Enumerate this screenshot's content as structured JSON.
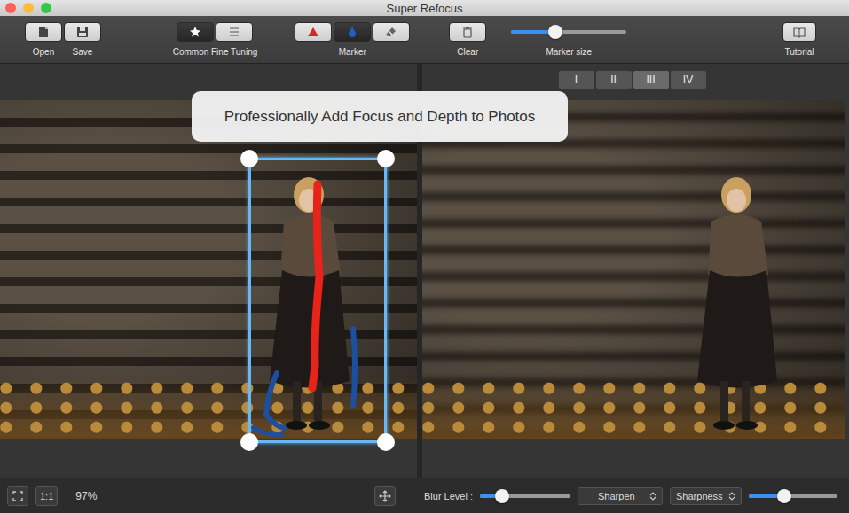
{
  "window": {
    "title": "Super Refocus"
  },
  "toolbar": {
    "file": [
      {
        "label": "Open"
      },
      {
        "label": "Save"
      }
    ],
    "mode": [
      {
        "label": "Common",
        "selected": true
      },
      {
        "label": "Fine Tuning",
        "selected": false
      }
    ],
    "marker": {
      "label": "Marker",
      "tools": [
        {
          "selected": false
        },
        {
          "selected": true
        },
        {
          "selected": false
        }
      ]
    },
    "clear": {
      "label": "Clear"
    },
    "marker_size": {
      "label": "Marker size",
      "level": 0.38
    },
    "tutorial": {
      "label": "Tutorial"
    }
  },
  "tooltip": {
    "text": "Professionally Add Focus and Depth to Photos"
  },
  "preview_tabs": [
    {
      "label": "I",
      "selected": false
    },
    {
      "label": "II",
      "selected": false
    },
    {
      "label": "III",
      "selected": true
    },
    {
      "label": "IV",
      "selected": false
    }
  ],
  "left_status": {
    "actual_size": "1:1",
    "zoom": "97%"
  },
  "right_status": {
    "blur": {
      "label": "Blur Level :",
      "level": 0.24
    },
    "filter_select": {
      "value": "Sharpen"
    },
    "amount_select": {
      "value": "Sharpness"
    },
    "amount": {
      "level": 0.4
    }
  }
}
